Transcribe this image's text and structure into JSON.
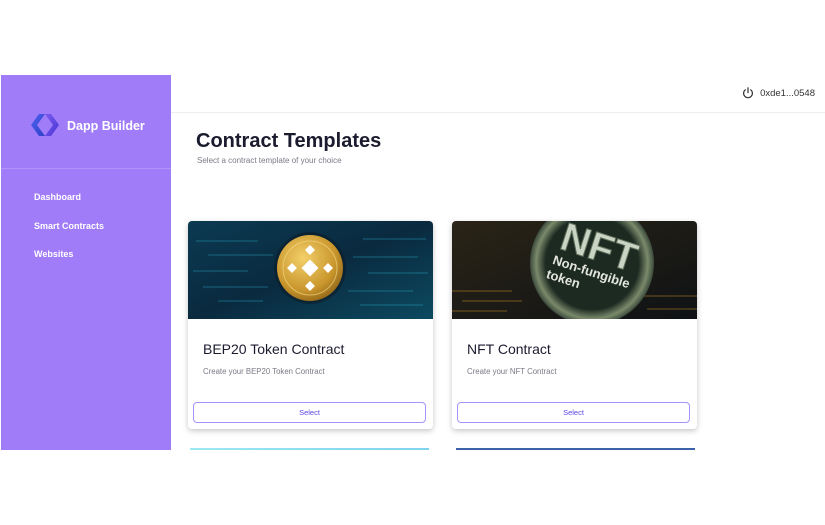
{
  "brand": {
    "name": "Dapp Builder"
  },
  "sidebar": {
    "items": [
      {
        "label": "Dashboard"
      },
      {
        "label": "Smart Contracts"
      },
      {
        "label": "Websites"
      }
    ]
  },
  "header": {
    "wallet_address": "0xde1...0548",
    "wallet_icon": "power-icon"
  },
  "main": {
    "title": "Contract Templates",
    "subtitle": "Select a contract template of your choice",
    "cards": [
      {
        "title": "BEP20 Token Contract",
        "description": "Create your BEP20 Token Contract",
        "button_label": "Select",
        "image_icon": "binance-coin-icon"
      },
      {
        "title": "NFT Contract",
        "description": "Create your NFT Contract",
        "button_label": "Select",
        "image_text_big": "NFT",
        "image_text_small_1": "Non-fungible",
        "image_text_small_2": "token"
      }
    ]
  },
  "colors": {
    "sidebar": "#a07cf9",
    "accent": "#5b46e5",
    "button_border": "#a594f9"
  }
}
